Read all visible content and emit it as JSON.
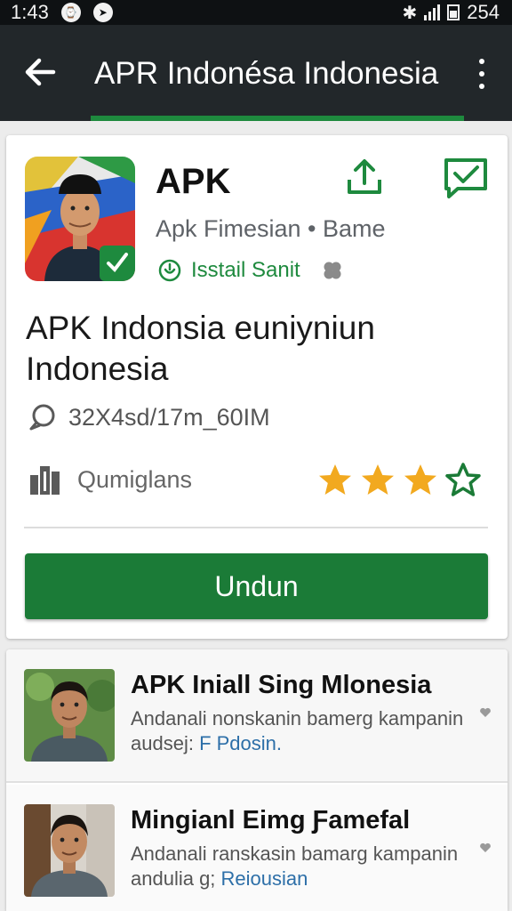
{
  "status_bar": {
    "time": "1:43",
    "battery_text": "254",
    "icons": [
      "alarm-icon",
      "navigation-icon",
      "bluetooth-icon",
      "signal-icon",
      "battery-icon"
    ]
  },
  "app_bar": {
    "title": "APR Indonésa Indonesia",
    "back_icon": "arrow-left-icon",
    "menu_icon": "more-vert-icon"
  },
  "app_card": {
    "name": "APK",
    "meta": "Apk Fimesian • Bame",
    "install_status": "Isstail Sanit",
    "headline": "APK Indonsia euniyniun Indonesia",
    "size_info": "32X4sd/17m_60IM",
    "developer": "Qumiglans",
    "rating": {
      "filled": 3,
      "total": 4
    },
    "button_label": "Undun"
  },
  "related": [
    {
      "title": "APK Iniall Sing Mlonesia",
      "desc_prefix": "Andanali nonskanin bamerg kampanin audsej:",
      "desc_tag": "F Pdosin."
    },
    {
      "title": "Mingianl Eimg Ƒamefal",
      "desc_prefix": "Andanali ranskasin bamarg kampanin andulia g;",
      "desc_tag": "Reiousian"
    }
  ],
  "colors": {
    "status_bar": "#0e1113",
    "app_bar": "#22272a",
    "accent_green": "#1b7b37",
    "star_fill": "#f2a91f",
    "link_blue": "#2d6fa8"
  }
}
